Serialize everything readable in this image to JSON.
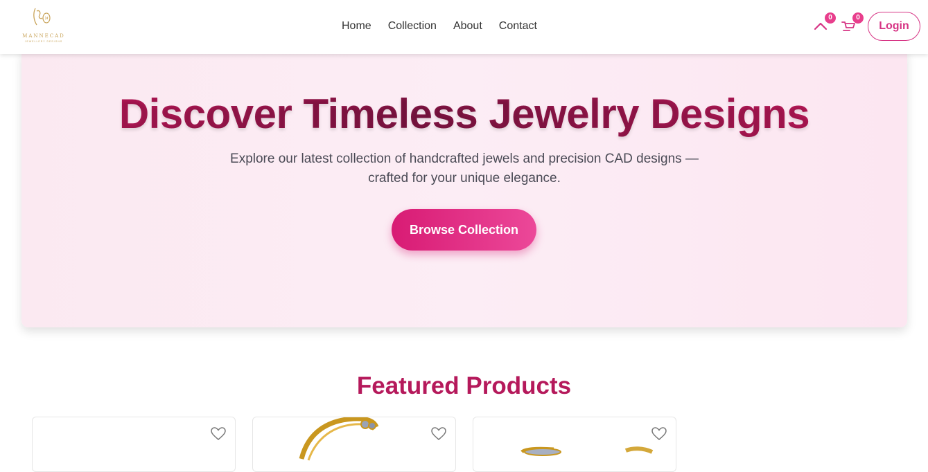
{
  "brand": {
    "logo_text": "MANNECAD",
    "logo_subtext": "JEWELLERY DESIGNS"
  },
  "nav": {
    "links": [
      "Home",
      "Collection",
      "About",
      "Contact"
    ],
    "wishlist_count": "0",
    "cart_count": "0",
    "login_label": "Login"
  },
  "hero": {
    "title": "Discover Timeless Jewelry Designs",
    "subtitle": "Explore our latest collection of handcrafted jewels and precision CAD designs — crafted for your unique elegance.",
    "button_label": "Browse Collection"
  },
  "featured": {
    "title": "Featured Products",
    "cards": [
      {
        "image": "empty",
        "icon": "heart-icon"
      },
      {
        "image": "gold-ring",
        "icon": "heart-icon"
      },
      {
        "image": "gold-diamond-ring",
        "icon": "heart-icon"
      }
    ]
  },
  "colors": {
    "accent": "#d63384",
    "title_dark": "#7e1442",
    "gold": "#c9a45a"
  }
}
